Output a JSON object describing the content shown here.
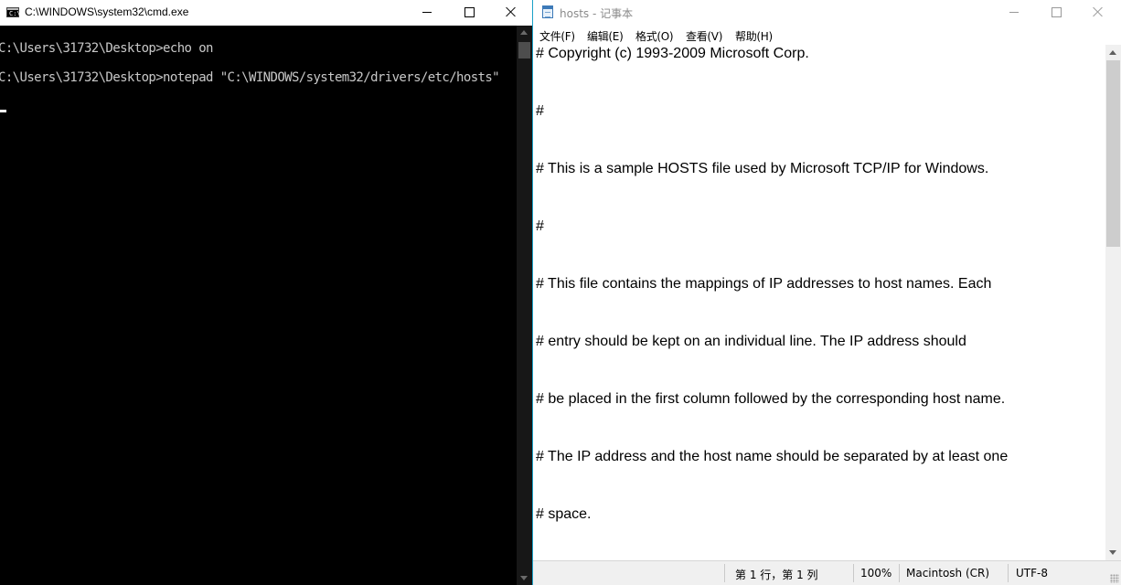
{
  "cmd": {
    "title": "C:\\WINDOWS\\system32\\cmd.exe",
    "icon_text": "C:\\",
    "lines": [
      "C:\\Users\\31732\\Desktop>echo on",
      "C:\\Users\\31732\\Desktop>notepad \"C:\\WINDOWS/system32/drivers/etc/hosts\""
    ]
  },
  "notepad": {
    "title": "hosts - 记事本",
    "menu": [
      "文件(F)",
      "编辑(E)",
      "格式(O)",
      "查看(V)",
      "帮助(H)"
    ],
    "lines": [
      "# Copyright (c) 1993-2009 Microsoft Corp.",
      "#",
      "# This is a sample HOSTS file used by Microsoft TCP/IP for Windows.",
      "#",
      "# This file contains the mappings of IP addresses to host names. Each",
      "# entry should be kept on an individual line. The IP address should",
      "# be placed in the first column followed by the corresponding host name.",
      "# The IP address and the host name should be separated by at least one",
      "# space."
    ],
    "status": {
      "position": "第 1 行，第 1 列",
      "zoom": "100%",
      "line_ending": "Macintosh (CR)",
      "encoding": "UTF-8"
    }
  },
  "icons": [
    "cmd-app-icon",
    "minimize-icon",
    "maximize-icon",
    "close-icon",
    "notepad-app-icon",
    "scroll-up-icon",
    "scroll-down-icon",
    "resize-grip-icon"
  ],
  "colors": {
    "cmd_background": "#000000",
    "cmd_text": "#c8c8c8",
    "notepad_title_text": "#8a8a8a",
    "desktop": "#1aa1c8"
  }
}
